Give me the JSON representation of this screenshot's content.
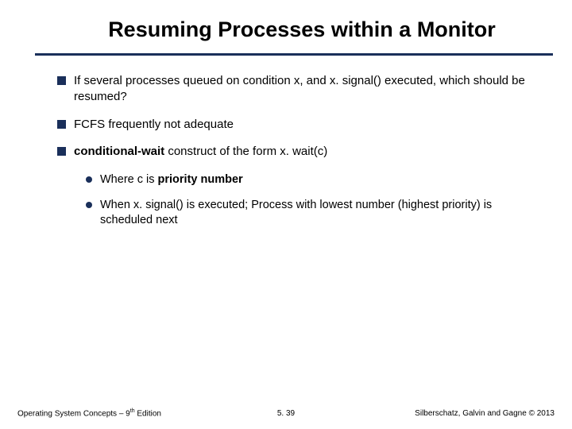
{
  "title": "Resuming Processes within a Monitor",
  "bullets": {
    "b1": "If several processes queued on condition x, and x. signal() executed, which should be resumed?",
    "b2": "FCFS frequently not adequate",
    "b3_pre": "conditional-wait",
    "b3_post": " construct of the form x. wait(c)",
    "s1_pre": "Where c is ",
    "s1_bold": "priority number",
    "s2": "When x. signal() is executed; Process with lowest number (highest priority) is scheduled next"
  },
  "footer": {
    "left_a": "Operating System Concepts – 9",
    "left_sup": "th",
    "left_b": " Edition",
    "center": "5. 39",
    "right": "Silberschatz, Galvin and Gagne © 2013"
  }
}
